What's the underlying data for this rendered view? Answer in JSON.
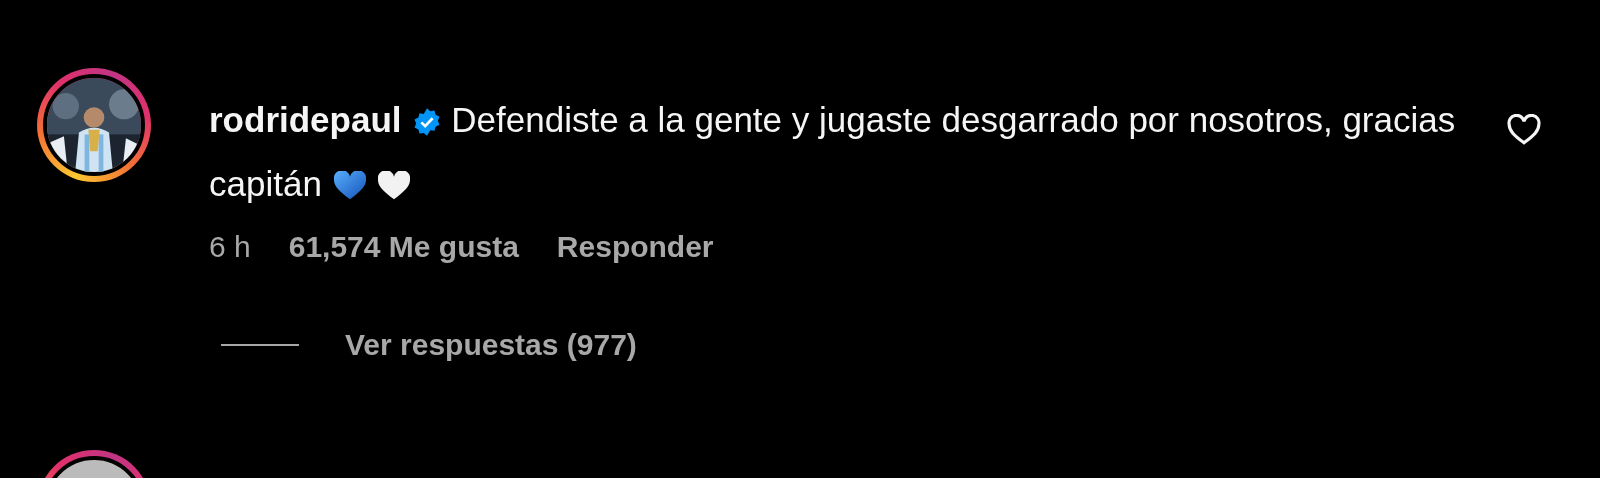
{
  "comments": [
    {
      "story_ring": true,
      "username": "rodridepaul",
      "verified": true,
      "text": "Defendiste a la gente y jugaste desgarrado por nosotros, gracias capitán",
      "time": "6 h",
      "likes": "61,574 Me gusta",
      "reply_label": "Responder",
      "liked": false,
      "replies_label": "Ver respuestas (977)"
    },
    {
      "story_ring": true
    }
  ]
}
